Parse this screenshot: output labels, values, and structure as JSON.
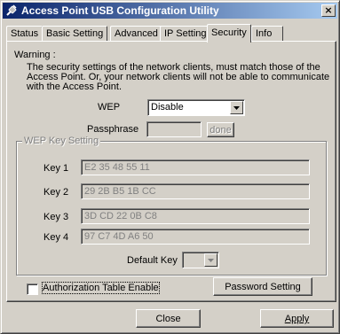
{
  "window": {
    "title": "Access Point USB Configuration Utility",
    "close_glyph": "×"
  },
  "tabs": [
    {
      "label": "Status"
    },
    {
      "label": "Basic Setting"
    },
    {
      "label": "Advanced"
    },
    {
      "label": "IP Setting"
    },
    {
      "label": "Security",
      "active": true
    },
    {
      "label": "Info"
    }
  ],
  "security": {
    "warning_label": "Warning :",
    "warning_text": "The security settings of the network clients, must match those of the Access Point. Or, your network clients will not be able to communicate with the Access Point.",
    "wep_label": "WEP",
    "wep_value": "Disable",
    "passphrase_label": "Passphrase",
    "passphrase_value": "",
    "done_label": "done",
    "group_title": "WEP Key Setting",
    "keys": [
      {
        "label": "Key 1",
        "value": "E2 35 48 55 11"
      },
      {
        "label": "Key 2",
        "value": "29 2B B5 1B CC"
      },
      {
        "label": "Key 3",
        "value": "3D CD 22 0B C8"
      },
      {
        "label": "Key 4",
        "value": "97 C7 4D A6 50"
      }
    ],
    "default_key_label": "Default Key",
    "default_key_value": "",
    "auth_table_label": "Authorization Table Enable",
    "auth_table_checked": false,
    "password_setting_label": "Password Setting"
  },
  "footer": {
    "close_label": "Close",
    "apply_label": "Apply"
  },
  "colors": {
    "title_start": "#0a246a",
    "title_end": "#a6caf0",
    "face": "#d4d0c8"
  }
}
